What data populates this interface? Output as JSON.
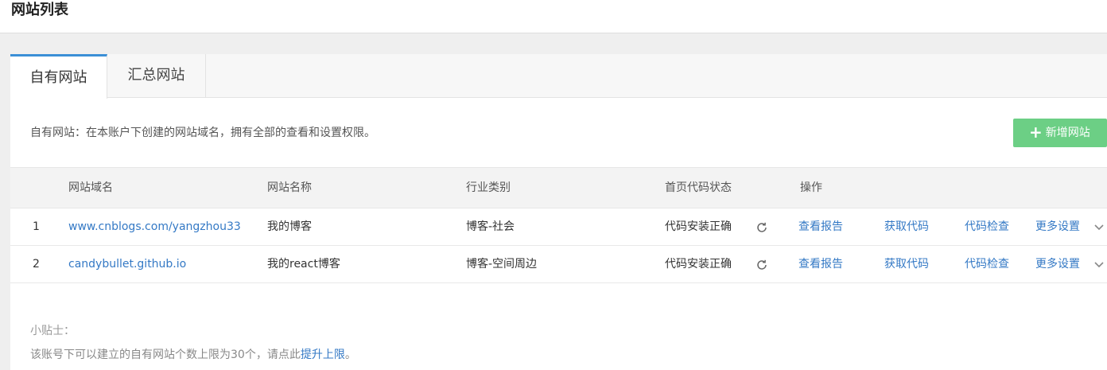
{
  "header": {
    "title": "网站列表"
  },
  "tabs": [
    {
      "label": "自有网站",
      "active": true
    },
    {
      "label": "汇总网站",
      "active": false
    }
  ],
  "description": "自有网站：在本账户下创建的网站域名，拥有全部的查看和设置权限。",
  "add_button": {
    "label": "新增网站",
    "icon": "plus-icon"
  },
  "table": {
    "columns": [
      "网站域名",
      "网站名称",
      "行业类别",
      "首页代码状态",
      "操作"
    ],
    "rows": [
      {
        "index": "1",
        "domain": "www.cnblogs.com/yangzhou33",
        "name": "我的博客",
        "category": "博客-社会",
        "status": "代码安装正确",
        "actions": [
          "查看报告",
          "获取代码",
          "代码检查",
          "更多设置"
        ]
      },
      {
        "index": "2",
        "domain": "candybullet.github.io",
        "name": "我的react博客",
        "category": "博客-空间周边",
        "status": "代码安装正确",
        "actions": [
          "查看报告",
          "获取代码",
          "代码检查",
          "更多设置"
        ]
      }
    ]
  },
  "tips": {
    "title": "小贴士：",
    "text_before": "该账号下可以建立的自有网站个数上限为30个，请点此",
    "link": "提升上限",
    "text_after": "。"
  },
  "colors": {
    "accent": "#3b8fd6",
    "link": "#3479c5",
    "add_button": "#6ccf85"
  }
}
